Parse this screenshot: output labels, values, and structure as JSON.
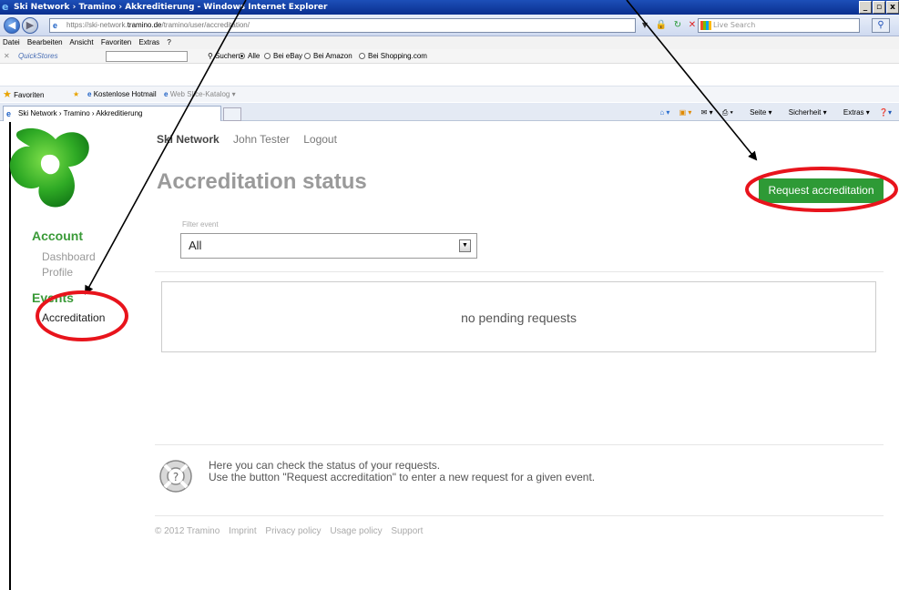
{
  "browser": {
    "title": "Ski Network › Tramino › Akkreditierung - Windows Internet Explorer",
    "url_prefix": "https://ski-network.",
    "url_domain": "tramino.de",
    "url_path": "/tramino/user/accreditation/",
    "live_search_placeholder": "Live Search",
    "menu": [
      "Datei",
      "Bearbeiten",
      "Ansicht",
      "Favoriten",
      "Extras",
      "?"
    ],
    "quickstores_label": "QuickStores",
    "quickstores_search": "Suchen",
    "quickstores_options": [
      "Alle",
      "Bei eBay",
      "Bei Amazon",
      "Bei Shopping.com"
    ],
    "favorites_label": "Favoriten",
    "favorites_items": [
      "Kostenlose Hotmail",
      "Web Slice-Katalog"
    ],
    "tab_title": "Ski Network › Tramino › Akkreditierung",
    "command_items": [
      "Seite",
      "Sicherheit",
      "Extras"
    ]
  },
  "topnav": {
    "brand": "Ski Network",
    "user": "John Tester",
    "logout": "Logout"
  },
  "page": {
    "title": "Accreditation status",
    "request_button": "Request accreditation",
    "filter_label": "Filter event",
    "filter_value": "All",
    "empty_message": "no pending requests",
    "help_line1": "Here you can check the status of your requests.",
    "help_line2": "Use the button \"Request accreditation\" to enter a new request for a given event."
  },
  "sidebar": {
    "account_heading": "Account",
    "account_items": [
      "Dashboard",
      "Profile"
    ],
    "events_heading": "Events",
    "events_items": [
      "Accreditation"
    ]
  },
  "footer": {
    "copyright": "© 2012 Tramino",
    "links": [
      "Imprint",
      "Privacy policy",
      "Usage policy",
      "Support"
    ]
  },
  "colors": {
    "brand_green": "#2e9a36",
    "annotation_red": "#e8141c"
  }
}
